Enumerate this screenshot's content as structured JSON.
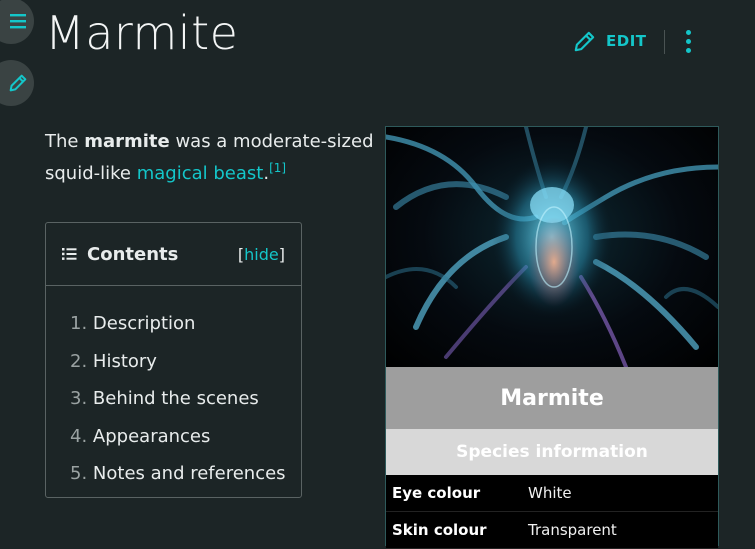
{
  "page": {
    "title": "Marmite"
  },
  "header": {
    "edit_label": "EDIT"
  },
  "intro": {
    "part1": "The ",
    "bold": "marmite",
    "part2": " was a moderate-sized squid-like ",
    "link": "magical beast",
    "part3": ".",
    "ref": "[1]"
  },
  "toc": {
    "title": "Contents",
    "hide_open": "[",
    "hide_label": "hide",
    "hide_close": "]",
    "items": [
      {
        "num": "1.",
        "label": "Description"
      },
      {
        "num": "2.",
        "label": "History"
      },
      {
        "num": "3.",
        "label": "Behind the scenes"
      },
      {
        "num": "4.",
        "label": "Appearances"
      },
      {
        "num": "5.",
        "label": "Notes and references"
      }
    ]
  },
  "infobox": {
    "name": "Marmite",
    "section": "Species information",
    "rows": [
      {
        "key": "Eye colour",
        "value": "White"
      },
      {
        "key": "Skin colour",
        "value": "Transparent"
      }
    ]
  },
  "colors": {
    "accent": "#14c6c9",
    "background": "#1c2526",
    "infobox_name_bg": "#9e9e9e",
    "infobox_section_bg": "#d8d8d8"
  }
}
